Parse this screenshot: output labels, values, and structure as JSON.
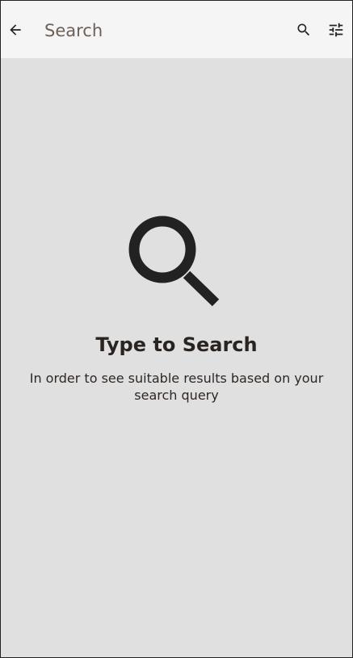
{
  "toolbar": {
    "back_icon": "arrow-left-icon",
    "search_placeholder": "Search",
    "search_value": "",
    "search_icon": "magnifier-icon",
    "filter_icon": "tune-sliders-icon"
  },
  "empty_state": {
    "icon": "magnifier-icon",
    "title": "Type to Search",
    "description": "In order to see suitable results based on your search query"
  },
  "colors": {
    "toolbar_bg": "#f5f5f5",
    "content_bg": "#e0e0e0",
    "icon": "#222222",
    "text": "#2a2421",
    "placeholder": "#6d6058"
  }
}
